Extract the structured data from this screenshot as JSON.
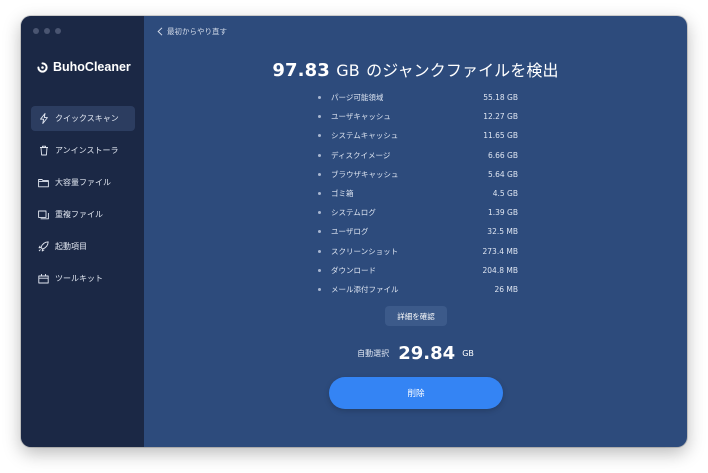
{
  "app": {
    "name": "BuhoCleaner",
    "colors": {
      "sidebar": "#1b2845",
      "main": "#2d4b7c",
      "accent": "#3484f4",
      "logo": "#3d8cf7"
    }
  },
  "sidebar": {
    "items": [
      {
        "label": "クイックスキャン",
        "icon": "lightning-icon",
        "active": true
      },
      {
        "label": "アンインストーラ",
        "icon": "trash-icon",
        "active": false
      },
      {
        "label": "大容量ファイル",
        "icon": "folder-icon",
        "active": false
      },
      {
        "label": "重複ファイル",
        "icon": "duplicate-icon",
        "active": false
      },
      {
        "label": "起動項目",
        "icon": "rocket-icon",
        "active": false
      },
      {
        "label": "ツールキット",
        "icon": "toolbox-icon",
        "active": false
      }
    ]
  },
  "header": {
    "back_label": "最初からやり直す"
  },
  "summary": {
    "total_value": "97.83",
    "total_unit": "GB",
    "title_suffix": "のジャンクファイルを検出"
  },
  "junk_items": [
    {
      "name": "パージ可能領域",
      "size": "55.18 GB"
    },
    {
      "name": "ユーザキャッシュ",
      "size": "12.27 GB"
    },
    {
      "name": "システムキャッシュ",
      "size": "11.65 GB"
    },
    {
      "name": "ディスクイメージ",
      "size": "6.66 GB"
    },
    {
      "name": "ブラウザキャッシュ",
      "size": "5.64 GB"
    },
    {
      "name": "ゴミ箱",
      "size": "4.5 GB"
    },
    {
      "name": "システムログ",
      "size": "1.39 GB"
    },
    {
      "name": "ユーザログ",
      "size": "32.5 MB"
    },
    {
      "name": "スクリーンショット",
      "size": "273.4 MB"
    },
    {
      "name": "ダウンロード",
      "size": "204.8 MB"
    },
    {
      "name": "メール添付ファイル",
      "size": "26 MB"
    }
  ],
  "details_button": "詳細を確認",
  "selection": {
    "label": "自動選択",
    "value": "29.84",
    "unit": "GB"
  },
  "delete_button": "削除"
}
